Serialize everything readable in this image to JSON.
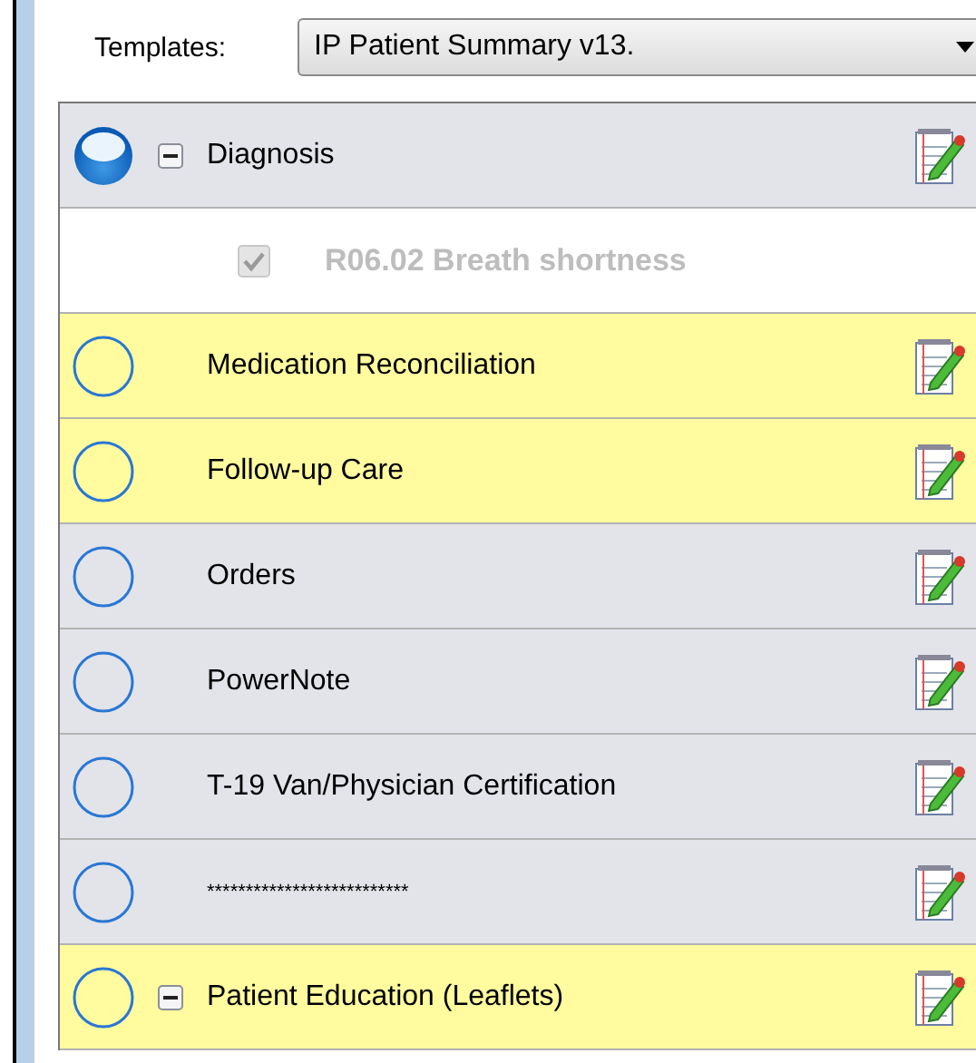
{
  "templates": {
    "label": "Templates:",
    "value": "IP Patient Summary v13."
  },
  "sections": [
    {
      "title": "Diagnosis",
      "completed": true,
      "highlighted": false,
      "expanded": true,
      "children": [
        {
          "label": "R06.02 Breath shortness",
          "checked": true,
          "disabled": true
        }
      ]
    },
    {
      "title": "Medication Reconciliation",
      "completed": false,
      "highlighted": true
    },
    {
      "title": "Follow-up Care",
      "completed": false,
      "highlighted": true
    },
    {
      "title": "Orders",
      "completed": false,
      "highlighted": false
    },
    {
      "title": "PowerNote",
      "completed": false,
      "highlighted": false
    },
    {
      "title": "T-19 Van/Physician Certification",
      "completed": false,
      "highlighted": false
    },
    {
      "title": "**************************",
      "completed": false,
      "highlighted": false
    },
    {
      "title": "Patient Education (Leaflets)",
      "completed": false,
      "highlighted": true,
      "expanded": true
    }
  ]
}
